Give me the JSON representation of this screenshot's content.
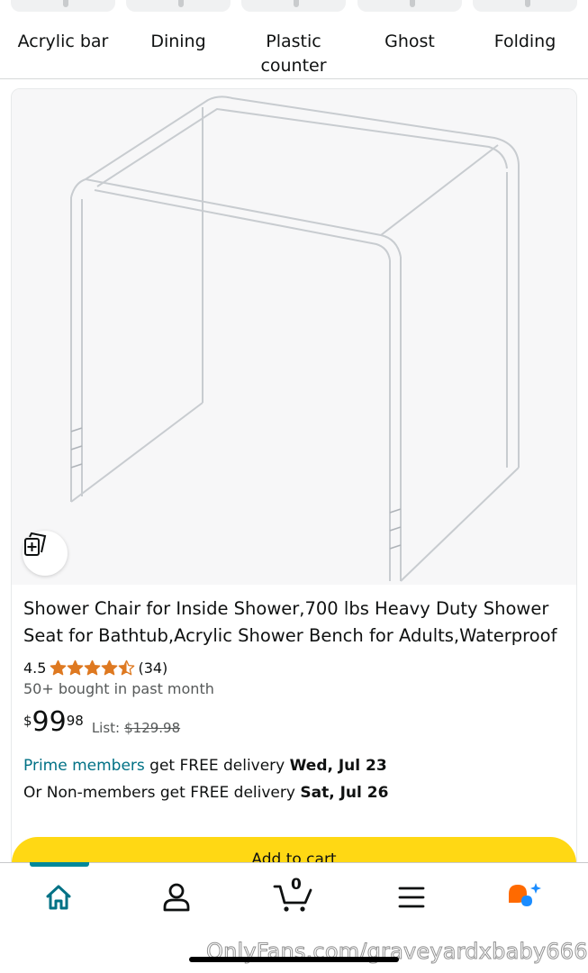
{
  "categories": [
    {
      "label": "Acrylic bar"
    },
    {
      "label": "Dining"
    },
    {
      "label": "Plastic counter"
    },
    {
      "label": "Ghost"
    },
    {
      "label": "Folding"
    }
  ],
  "product": {
    "title": "Shower Chair for Inside Shower,700 lbs Heavy Duty Shower Seat for Bathtub,Acrylic Shower Bench for Adults,Waterproof",
    "rating": "4.5",
    "rating_value": 4.5,
    "rating_count": "(34)",
    "bought": "50+ bought in past month",
    "price_symbol": "$",
    "price_whole": "99",
    "price_fraction": "98",
    "list_label": "List:",
    "list_price": "$129.98",
    "prime_link": "Prime members",
    "prime_text": " get FREE delivery ",
    "prime_date": "Wed, Jul 23",
    "nonmember_text": "Or Non-members get FREE delivery ",
    "nonmember_date": "Sat, Jul 26",
    "add_to_cart": "Add to cart",
    "image_icon": "acrylic-bench-image",
    "similar_icon": "view-similar-icon"
  },
  "nav": {
    "items": [
      {
        "name": "home",
        "icon": "home-icon"
      },
      {
        "name": "account",
        "icon": "account-icon"
      },
      {
        "name": "cart",
        "icon": "cart-icon"
      },
      {
        "name": "menu",
        "icon": "menu-icon"
      },
      {
        "name": "rufus",
        "icon": "ai-assistant-icon"
      }
    ],
    "cart_count": "0",
    "active": "home"
  },
  "watermark": "OnlyFans.com/graveyardxbaby666",
  "colors": {
    "accent": "#007185",
    "nav_active": "#00889a",
    "star": "#de7921",
    "add_to_cart": "#ffd814",
    "ai_orange": "#ff6a00",
    "ai_blue": "#1a8cff"
  }
}
